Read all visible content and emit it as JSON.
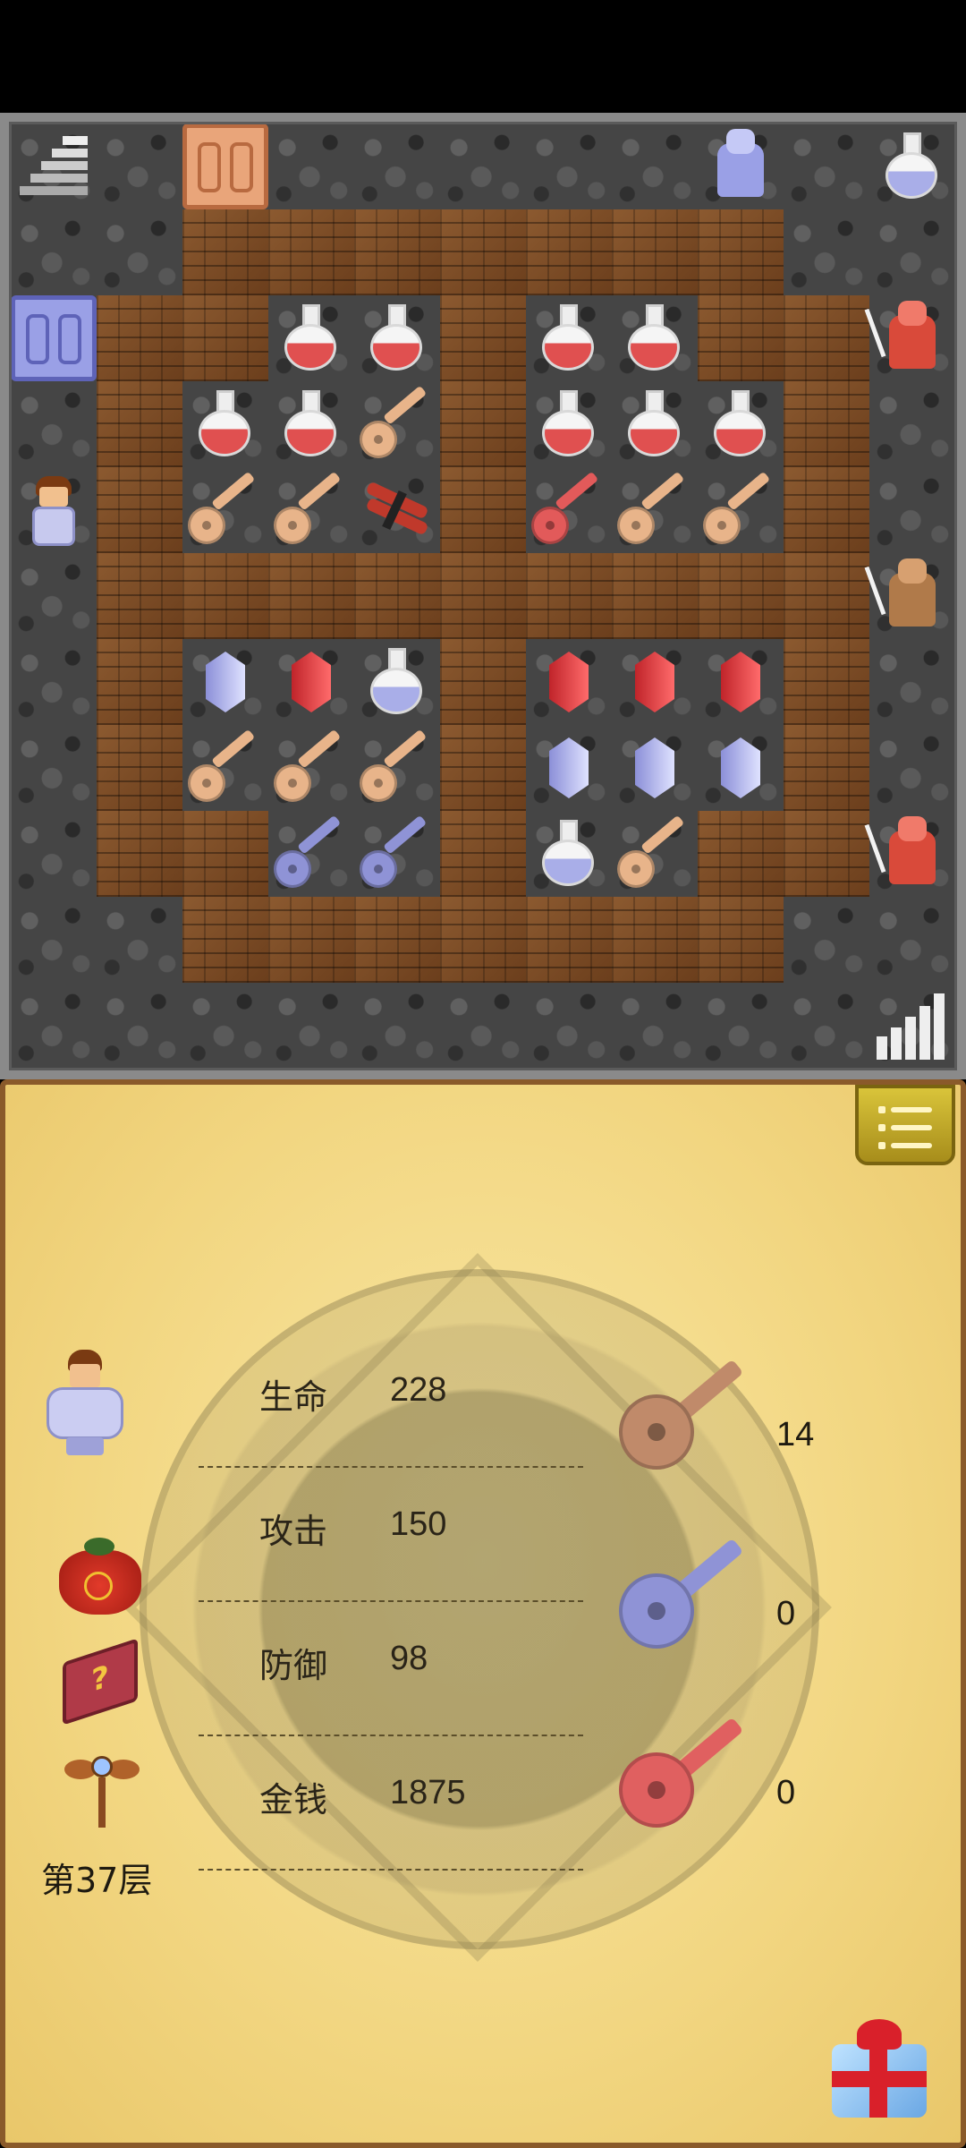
{
  "board": {
    "tiles": [
      "SSSSSSSSSSS",
      "SSBBBBBBBSS",
      "SBB..B..BBS",
      "SB...B...BS",
      "SB...B...BS",
      "SBBBBBBBBBS",
      "SB...B...BS",
      "SB...B...BS",
      "SBB..B..BBS",
      "SSBBBBBBBSS",
      "SSSSSSSSSSS"
    ],
    "items": [
      {
        "type": "stairs-down",
        "r": 0,
        "c": 0
      },
      {
        "type": "door-orange",
        "r": 0,
        "c": 2
      },
      {
        "type": "armor-knight",
        "r": 0,
        "c": 8
      },
      {
        "type": "potion-blue",
        "r": 0,
        "c": 10
      },
      {
        "type": "door-blue",
        "r": 2,
        "c": 0
      },
      {
        "type": "potion-red",
        "r": 2,
        "c": 3
      },
      {
        "type": "potion-red",
        "r": 2,
        "c": 4
      },
      {
        "type": "potion-red",
        "r": 2,
        "c": 6
      },
      {
        "type": "potion-red",
        "r": 2,
        "c": 7
      },
      {
        "type": "red-knight",
        "r": 2,
        "c": 10
      },
      {
        "type": "potion-red",
        "r": 3,
        "c": 2
      },
      {
        "type": "potion-red",
        "r": 3,
        "c": 3
      },
      {
        "type": "key-yellow",
        "r": 3,
        "c": 4
      },
      {
        "type": "potion-red",
        "r": 3,
        "c": 6
      },
      {
        "type": "potion-red",
        "r": 3,
        "c": 7
      },
      {
        "type": "potion-red",
        "r": 3,
        "c": 8
      },
      {
        "type": "hero",
        "r": 4,
        "c": 0
      },
      {
        "type": "key-yellow",
        "r": 4,
        "c": 2
      },
      {
        "type": "key-yellow",
        "r": 4,
        "c": 3
      },
      {
        "type": "dynamite",
        "r": 4,
        "c": 4
      },
      {
        "type": "key-red",
        "r": 4,
        "c": 6
      },
      {
        "type": "key-yellow",
        "r": 4,
        "c": 7
      },
      {
        "type": "key-yellow",
        "r": 4,
        "c": 8
      },
      {
        "type": "rock-warrior",
        "r": 5,
        "c": 10
      },
      {
        "type": "gem-blue",
        "r": 6,
        "c": 2
      },
      {
        "type": "gem-red",
        "r": 6,
        "c": 3
      },
      {
        "type": "potion-blue",
        "r": 6,
        "c": 4
      },
      {
        "type": "gem-red",
        "r": 6,
        "c": 6
      },
      {
        "type": "gem-red",
        "r": 6,
        "c": 7
      },
      {
        "type": "gem-red",
        "r": 6,
        "c": 8
      },
      {
        "type": "key-yellow",
        "r": 7,
        "c": 2
      },
      {
        "type": "key-yellow",
        "r": 7,
        "c": 3
      },
      {
        "type": "key-yellow",
        "r": 7,
        "c": 4
      },
      {
        "type": "gem-blue",
        "r": 7,
        "c": 6
      },
      {
        "type": "gem-blue",
        "r": 7,
        "c": 7
      },
      {
        "type": "gem-blue",
        "r": 7,
        "c": 8
      },
      {
        "type": "key-blue",
        "r": 8,
        "c": 3
      },
      {
        "type": "key-blue",
        "r": 8,
        "c": 4
      },
      {
        "type": "potion-blue",
        "r": 8,
        "c": 6
      },
      {
        "type": "key-yellow",
        "r": 8,
        "c": 7
      },
      {
        "type": "red-knight",
        "r": 8,
        "c": 10
      },
      {
        "type": "stairs-up",
        "r": 10,
        "c": 10
      }
    ]
  },
  "colors": {
    "potion_red": "#e05050",
    "potion_blue": "#a9aee8",
    "key_yellow": "#e8b48a",
    "key_blue": "#8f93d6",
    "key_red": "#e25a5a",
    "gem_red": [
      "#c0242a",
      "#ff6b6b"
    ],
    "gem_blue": [
      "#8b8fd8",
      "#dfe2ff"
    ]
  },
  "status": {
    "floor": "第37层",
    "stats": [
      {
        "label": "生命",
        "value": "228"
      },
      {
        "label": "攻击",
        "value": "150"
      },
      {
        "label": "防御",
        "value": "98"
      },
      {
        "label": "金钱",
        "value": "1875"
      }
    ],
    "keys": [
      {
        "color": "yellow",
        "count": "14"
      },
      {
        "color": "blue",
        "count": "0"
      },
      {
        "color": "red",
        "count": "0"
      }
    ]
  },
  "icons": {
    "menu": "list-menu-icon",
    "hero": "hero-portrait-icon",
    "lucky_bag": "lucky-bag-icon",
    "monster_book": "monster-book-icon",
    "fly": "floor-fly-icon",
    "gift": "gift-box-icon"
  }
}
